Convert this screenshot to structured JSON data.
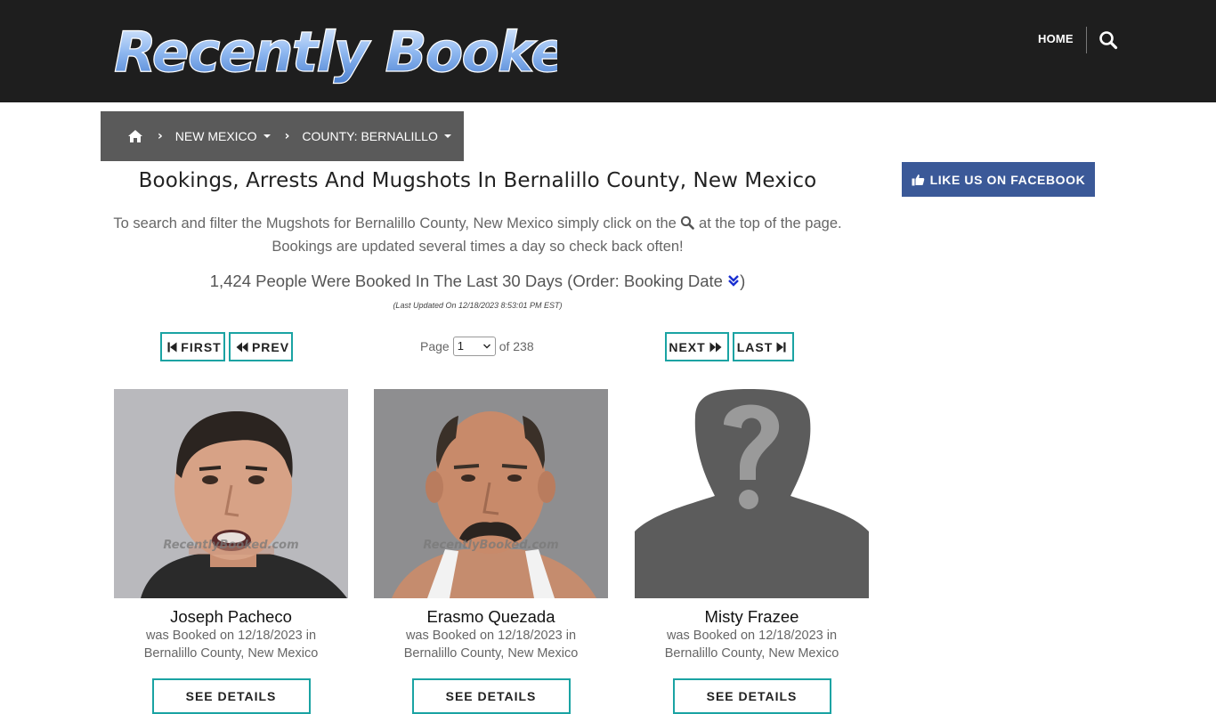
{
  "header": {
    "logo_text": "Recently Booked",
    "nav_home": "HOME",
    "search_icon": "search-icon"
  },
  "breadcrumb": {
    "home_icon": "home-icon",
    "items": [
      {
        "label": "NEW MEXICO"
      },
      {
        "label": "COUNTY: BERNALILLO"
      }
    ]
  },
  "sidebar": {
    "facebook_label": "LIKE US ON FACEBOOK"
  },
  "main": {
    "title": "Bookings, Arrests And Mugshots In Bernalillo County, New Mexico",
    "intro_part1": "To search and filter the Mugshots for Bernalillo County, New Mexico simply click on the",
    "intro_part2": "at the top of the page.",
    "intro_line2": "Bookings are updated several times a day so check back often!",
    "count_text": "1,424 People Were Booked In The Last 30 Days (Order: Booking Date",
    "count_close": ")",
    "updated": "(Last Updated On 12/18/2023 8:53:01 PM EST)"
  },
  "pagination": {
    "first": "FIRST",
    "prev": "PREV",
    "next": "NEXT",
    "last": "LAST",
    "page_label": "Page",
    "current_page": "1",
    "of_label": "of 238"
  },
  "bookings": [
    {
      "name": "Joseph Pacheco",
      "booked": "was Booked on 12/18/2023 in",
      "location": "Bernalillo County, New Mexico",
      "watermark": "RecentlyBooked.com",
      "button": "SEE DETAILS"
    },
    {
      "name": "Erasmo Quezada",
      "booked": "was Booked on 12/18/2023 in",
      "location": "Bernalillo County, New Mexico",
      "watermark": "RecentlyBooked.com",
      "button": "SEE DETAILS"
    },
    {
      "name": "Misty Frazee",
      "booked": "was Booked on 12/18/2023 in",
      "location": "Bernalillo County, New Mexico",
      "button": "SEE DETAILS"
    }
  ],
  "colors": {
    "topbar": "#1e1e1e",
    "breadcrumb": "#5a5a5a",
    "facebook": "#3b5998",
    "accent_border": "#1aa3a3"
  }
}
